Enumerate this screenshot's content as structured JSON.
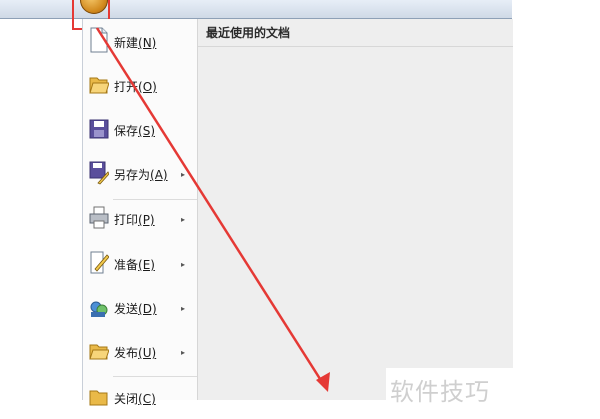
{
  "menu": {
    "commands": [
      {
        "label": "新建",
        "key": "(N)",
        "icon": "new-document-icon",
        "has_submenu": false
      },
      {
        "label": "打开",
        "key": "(O)",
        "icon": "open-folder-icon",
        "has_submenu": false
      },
      {
        "label": "保存",
        "key": "(S)",
        "icon": "save-icon",
        "has_submenu": false
      },
      {
        "label": "另存为",
        "key": "(A)",
        "icon": "save-as-icon",
        "has_submenu": true
      },
      {
        "label": "打印",
        "key": "(P)",
        "icon": "print-icon",
        "has_submenu": true
      },
      {
        "label": "准备",
        "key": "(E)",
        "icon": "prepare-icon",
        "has_submenu": true
      },
      {
        "label": "发送",
        "key": "(D)",
        "icon": "send-icon",
        "has_submenu": true
      },
      {
        "label": "发布",
        "key": "(U)",
        "icon": "publish-icon",
        "has_submenu": true
      },
      {
        "label": "关闭",
        "key": "(C)",
        "icon": "close-folder-icon",
        "has_submenu": false
      }
    ],
    "submenu_arrow": "▸"
  },
  "recent": {
    "title": "最近使用的文档"
  },
  "watermark": {
    "text": "软件技巧"
  },
  "annotation": {
    "color": "#e53935"
  }
}
